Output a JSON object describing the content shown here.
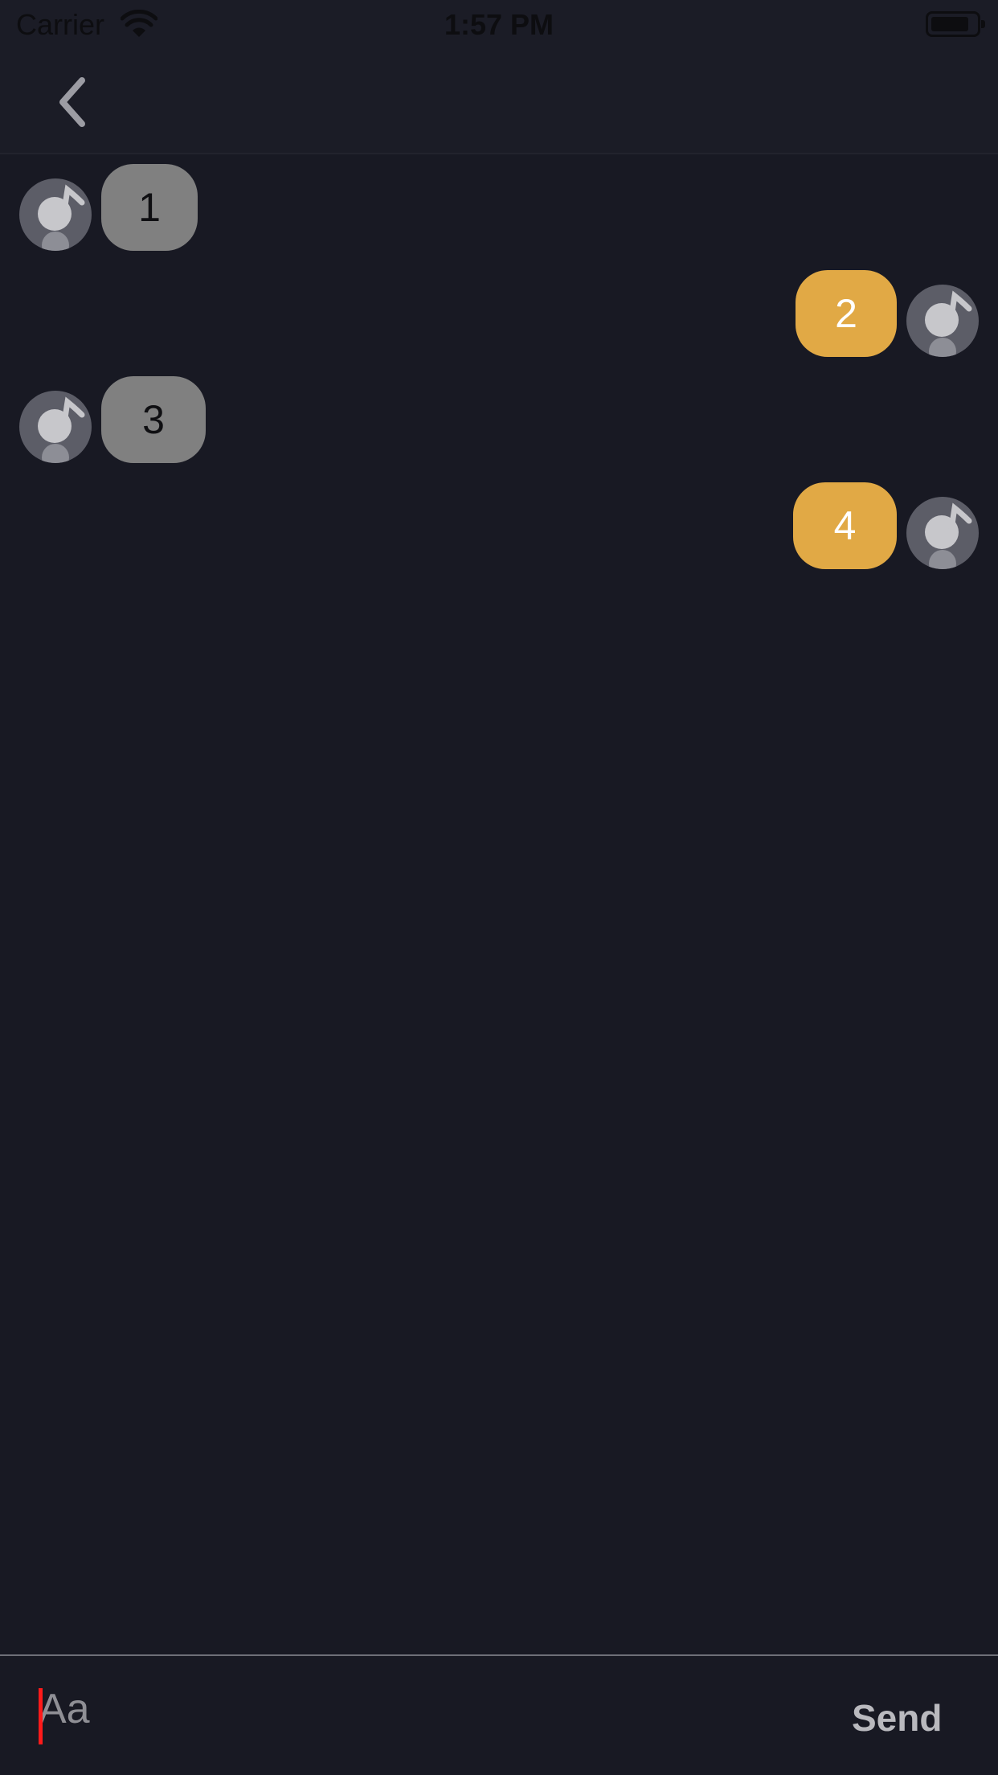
{
  "status_bar": {
    "carrier": "Carrier",
    "time": "1:57 PM",
    "wifi_icon": "wifi-icon",
    "battery_icon": "battery-icon"
  },
  "nav": {
    "back_icon": "chevron-left-icon"
  },
  "messages": [
    {
      "side": "incoming",
      "text": "1"
    },
    {
      "side": "outgoing",
      "text": "2"
    },
    {
      "side": "incoming",
      "text": "3"
    },
    {
      "side": "outgoing",
      "text": "4"
    }
  ],
  "composer": {
    "placeholder": "Aa",
    "send_label": "Send"
  },
  "colors": {
    "background": "#181923",
    "incoming_bubble": "#808080",
    "outgoing_bubble": "#e1a945",
    "cursor": "#ff1a1a"
  }
}
